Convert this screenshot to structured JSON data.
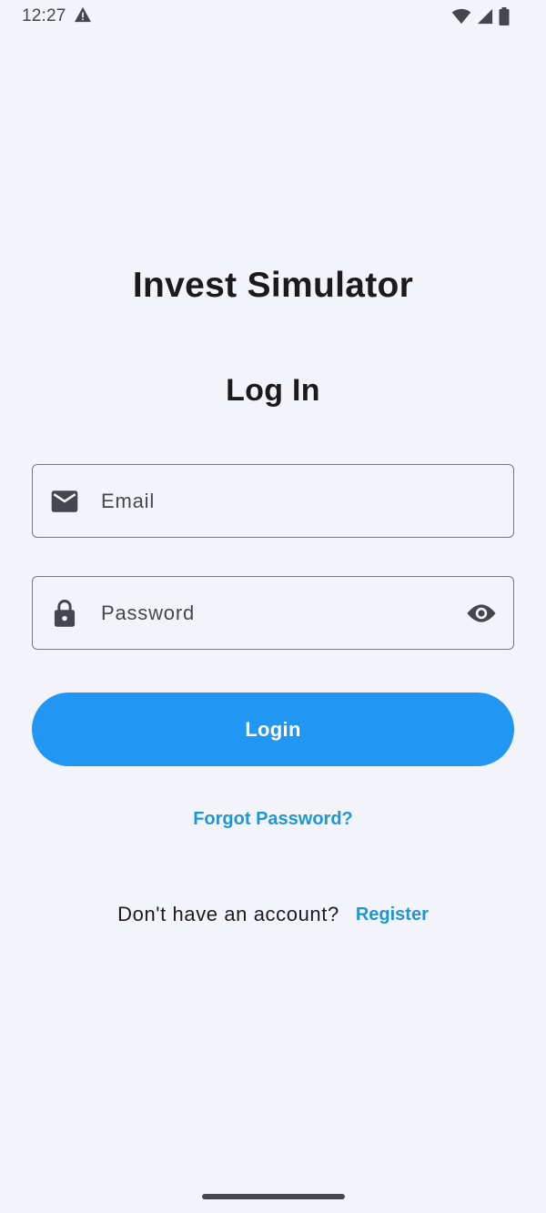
{
  "status_bar": {
    "time": "12:27",
    "icons": [
      "alert-icon",
      "wifi-icon",
      "cellular-icon",
      "battery-icon"
    ]
  },
  "app": {
    "title": "Invest Simulator"
  },
  "login": {
    "heading": "Log In",
    "email": {
      "value": "",
      "placeholder": "Email",
      "icon": "email-icon"
    },
    "password": {
      "value": "",
      "placeholder": "Password",
      "icon": "lock-icon",
      "toggle_icon": "eye-icon"
    },
    "login_button_label": "Login",
    "forgot_password_label": "Forgot Password?",
    "register_prompt": "Don't have an account?",
    "register_label": "Register"
  },
  "colors": {
    "background": "#f3f4f9",
    "primary": "#2196f3",
    "link": "#2196d3",
    "text": "#1b1b1f",
    "icon": "#45464f",
    "outline": "#76777f"
  }
}
